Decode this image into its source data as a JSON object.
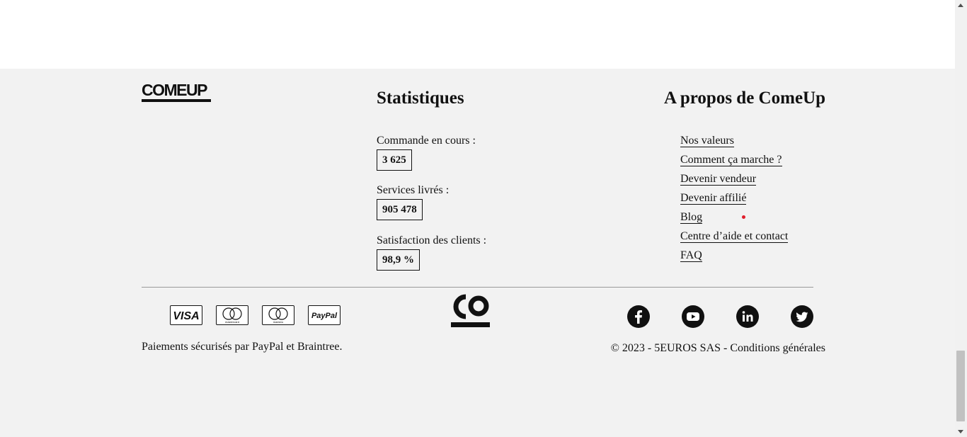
{
  "brand": {
    "logo_text": "COMEUP"
  },
  "stats": {
    "title": "Statistiques",
    "items": [
      {
        "label": "Commande en cours :",
        "value": "3 625"
      },
      {
        "label": "Services livrés :",
        "value": "905 478"
      },
      {
        "label": "Satisfaction des clients :",
        "value": "98,9 %"
      }
    ]
  },
  "about": {
    "title": "A propos de ComeUp",
    "links": [
      {
        "label": "Nos valeurs"
      },
      {
        "label": "Comment ça marche ?"
      },
      {
        "label": "Devenir vendeur"
      },
      {
        "label": "Devenir affilié"
      },
      {
        "label": "Blog"
      },
      {
        "label": "Centre d’aide et contact"
      },
      {
        "label": "FAQ"
      }
    ],
    "notification_color": "#e01e2c"
  },
  "payments": {
    "cards": [
      {
        "name": "visa-card-icon",
        "text": "VISA"
      },
      {
        "name": "mastercard-icon",
        "text": "mastercard"
      },
      {
        "name": "maestro-icon",
        "text": "maestro"
      },
      {
        "name": "paypal-icon",
        "text": "PayPal"
      }
    ],
    "caption": "Paiements sécurisés par PayPal et Braintree."
  },
  "social": [
    "facebook-icon",
    "youtube-icon",
    "linkedin-icon",
    "twitter-icon"
  ],
  "copyright": {
    "text": "© 2023 - 5EUROS SAS - ",
    "link": "Conditions générales"
  },
  "colors": {
    "footer_bg": "#f2f2f2",
    "text": "#111111"
  }
}
